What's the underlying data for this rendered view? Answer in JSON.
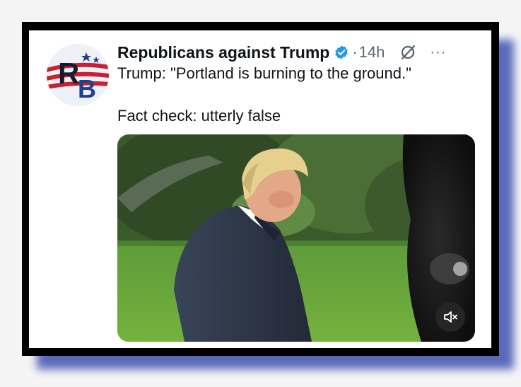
{
  "tweet": {
    "author_name": "Republicans against Trump",
    "verified": true,
    "separator": "·",
    "time": "14h",
    "more": "···",
    "text_line_1": "Trump: \"Portland is burning to the ground.\"",
    "text_line_2": "Fact check: utterly false",
    "avatar_initials": "RB"
  },
  "icons": {
    "verified": "verified-badge-icon",
    "grok": "grok-icon",
    "more": "more-options-icon",
    "mute": "volume-muted-icon"
  },
  "colors": {
    "frame": "#000000",
    "shadow": "#4a5bb5",
    "verified_blue": "#1d9bf0",
    "secondary_text": "#536471",
    "avatar_red": "#c8202f",
    "avatar_blue": "#1f3f8f"
  }
}
